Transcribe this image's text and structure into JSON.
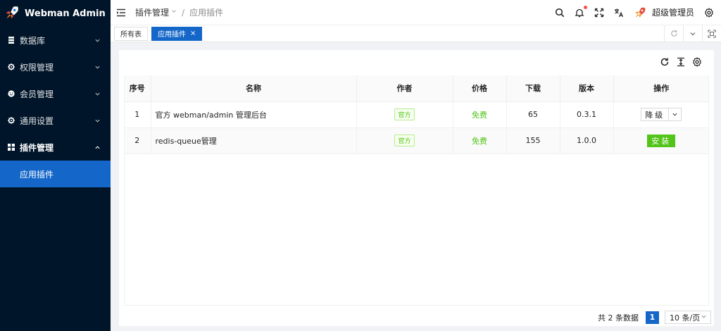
{
  "app": {
    "title": "Webman Admin"
  },
  "sidebar": {
    "items": [
      {
        "label": "数据库",
        "icon": "database-icon"
      },
      {
        "label": "权限管理",
        "icon": "gear-icon"
      },
      {
        "label": "会员管理",
        "icon": "smile-icon"
      },
      {
        "label": "通用设置",
        "icon": "gear-icon"
      },
      {
        "label": "插件管理",
        "icon": "grid-icon",
        "expanded": true
      }
    ],
    "submenu": {
      "label": "应用插件",
      "active": true
    }
  },
  "header": {
    "breadcrumb": {
      "parent": "插件管理",
      "separator": "/",
      "current": "应用插件"
    },
    "username": "超级管理员",
    "has_notification": true
  },
  "tabs": [
    {
      "label": "所有表",
      "active": false
    },
    {
      "label": "应用插件",
      "active": true,
      "close": "×"
    }
  ],
  "table": {
    "columns": [
      "序号",
      "名称",
      "作者",
      "价格",
      "下载",
      "版本",
      "操作"
    ],
    "rows": [
      {
        "index": "1",
        "name": "官方 webman/admin 管理后台",
        "author": "官方",
        "price": "免费",
        "downloads": "65",
        "version": "0.3.1",
        "action": "降级"
      },
      {
        "index": "2",
        "name": "redis-queue管理",
        "author": "官方",
        "price": "免费",
        "downloads": "155",
        "version": "1.0.0",
        "action": "安装"
      }
    ]
  },
  "pagination": {
    "total_text": "共 2 条数据",
    "current_page": "1",
    "page_size": "10 条/页"
  },
  "colors": {
    "sidebar_bg": "#001529",
    "primary": "#1467c9",
    "success": "#52c41a"
  }
}
